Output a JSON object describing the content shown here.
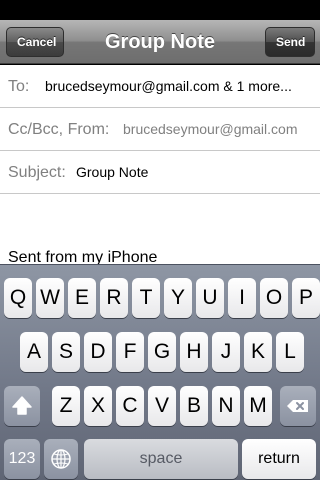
{
  "nav": {
    "title": "Group Note",
    "cancel_label": "Cancel",
    "send_label": "Send"
  },
  "fields": {
    "to_label": "To:",
    "to_value": "brucedseymour@gmail.com & 1 more...",
    "ccbcc_label": "Cc/Bcc, From:",
    "ccbcc_value": "brucedseymour@gmail.com",
    "subject_label": "Subject:",
    "subject_value": "Group Note"
  },
  "body": {
    "signature": "Sent from my iPhone"
  },
  "keyboard": {
    "row1": [
      "Q",
      "W",
      "E",
      "R",
      "T",
      "Y",
      "U",
      "I",
      "O",
      "P"
    ],
    "row2": [
      "A",
      "S",
      "D",
      "F",
      "G",
      "H",
      "J",
      "K",
      "L"
    ],
    "row3": [
      "Z",
      "X",
      "C",
      "V",
      "B",
      "N",
      "M"
    ],
    "numbers_label": "123",
    "space_label": "space",
    "return_label": "return",
    "icons": {
      "shift": "shift-arrow-icon",
      "delete": "backspace-icon",
      "globe": "globe-icon"
    }
  }
}
